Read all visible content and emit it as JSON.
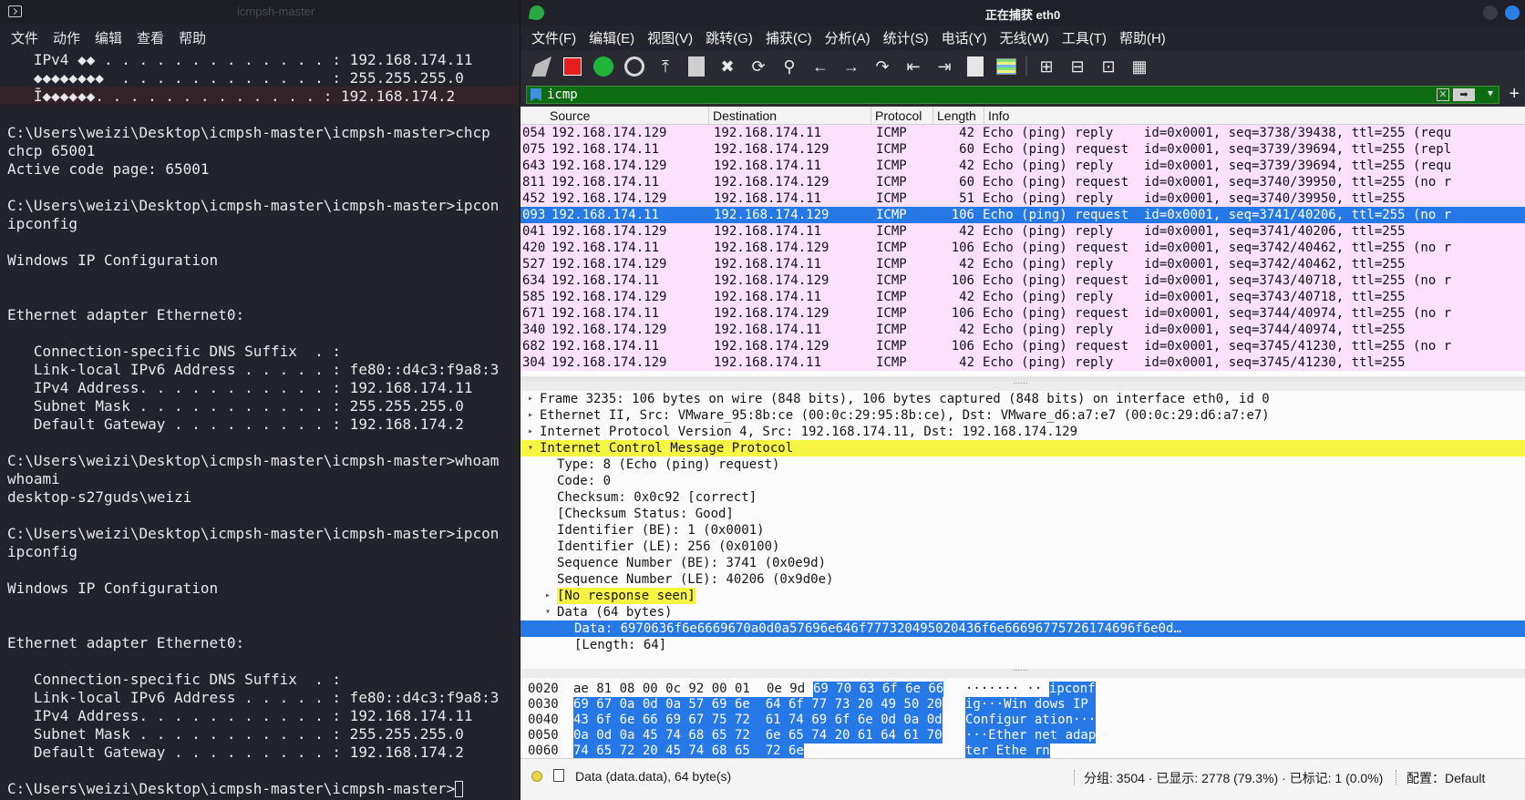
{
  "terminal": {
    "title": "icmpsh-master",
    "menu": [
      "文件",
      "动作",
      "编辑",
      "查看",
      "帮助"
    ],
    "lines": [
      "   IPv4 ◆◆ . . . . . . . . . . . . . : 192.168.174.11",
      "   ◆◆◆◆◆◆◆◆  . . . . . . . . . . . . : 255.255.255.0",
      "   Ī◆◆◆◆◆◆. . . . . . . . . . . . . : 192.168.174.2",
      "",
      "C:\\Users\\weizi\\Desktop\\icmpsh-master\\icmpsh-master>chcp",
      "chcp 65001",
      "Active code page: 65001",
      "",
      "C:\\Users\\weizi\\Desktop\\icmpsh-master\\icmpsh-master>ipcon",
      "ipconfig",
      "",
      "Windows IP Configuration",
      "",
      "",
      "Ethernet adapter Ethernet0:",
      "",
      "   Connection-specific DNS Suffix  . :",
      "   Link-local IPv6 Address . . . . . : fe80::d4c3:f9a8:3",
      "   IPv4 Address. . . . . . . . . . . : 192.168.174.11",
      "   Subnet Mask . . . . . . . . . . . : 255.255.255.0",
      "   Default Gateway . . . . . . . . . : 192.168.174.2",
      "",
      "C:\\Users\\weizi\\Desktop\\icmpsh-master\\icmpsh-master>whoam",
      "whoami",
      "desktop-s27guds\\weizi",
      "",
      "C:\\Users\\weizi\\Desktop\\icmpsh-master\\icmpsh-master>ipcon",
      "ipconfig",
      "",
      "Windows IP Configuration",
      "",
      "",
      "Ethernet adapter Ethernet0:",
      "",
      "   Connection-specific DNS Suffix  . :",
      "   Link-local IPv6 Address . . . . . : fe80::d4c3:f9a8:3",
      "   IPv4 Address. . . . . . . . . . . : 192.168.174.11",
      "   Subnet Mask . . . . . . . . . . . : 255.255.255.0",
      "   Default Gateway . . . . . . . . . : 192.168.174.2",
      ""
    ],
    "prompt": "C:\\Users\\weizi\\Desktop\\icmpsh-master\\icmpsh-master>"
  },
  "wireshark": {
    "title": "正在捕获 eth0",
    "menu": [
      "文件(F)",
      "编辑(E)",
      "视图(V)",
      "跳转(G)",
      "捕获(C)",
      "分析(A)",
      "统计(S)",
      "电话(Y)",
      "无线(W)",
      "工具(T)",
      "帮助(H)"
    ],
    "filter": "icmp",
    "columns": {
      "source": "Source",
      "destination": "Destination",
      "protocol": "Protocol",
      "length": "Length",
      "info": "Info"
    },
    "packets": [
      {
        "time": "054",
        "src": "192.168.174.129",
        "dst": "192.168.174.11",
        "proto": "ICMP",
        "len": "42",
        "info": "Echo (ping) reply    id=0x0001, seq=3738/39438, ttl=255 (requ"
      },
      {
        "time": "075",
        "src": "192.168.174.11",
        "dst": "192.168.174.129",
        "proto": "ICMP",
        "len": "60",
        "info": "Echo (ping) request  id=0x0001, seq=3739/39694, ttl=255 (repl"
      },
      {
        "time": "643",
        "src": "192.168.174.129",
        "dst": "192.168.174.11",
        "proto": "ICMP",
        "len": "42",
        "info": "Echo (ping) reply    id=0x0001, seq=3739/39694, ttl=255 (requ"
      },
      {
        "time": "811",
        "src": "192.168.174.11",
        "dst": "192.168.174.129",
        "proto": "ICMP",
        "len": "60",
        "info": "Echo (ping) request  id=0x0001, seq=3740/39950, ttl=255 (no r"
      },
      {
        "time": "452",
        "src": "192.168.174.129",
        "dst": "192.168.174.11",
        "proto": "ICMP",
        "len": "51",
        "info": "Echo (ping) reply    id=0x0001, seq=3740/39950, ttl=255"
      },
      {
        "time": "093",
        "src": "192.168.174.11",
        "dst": "192.168.174.129",
        "proto": "ICMP",
        "len": "106",
        "info": "Echo (ping) request  id=0x0001, seq=3741/40206, ttl=255 (no r",
        "selected": true
      },
      {
        "time": "041",
        "src": "192.168.174.129",
        "dst": "192.168.174.11",
        "proto": "ICMP",
        "len": "42",
        "info": "Echo (ping) reply    id=0x0001, seq=3741/40206, ttl=255"
      },
      {
        "time": "420",
        "src": "192.168.174.11",
        "dst": "192.168.174.129",
        "proto": "ICMP",
        "len": "106",
        "info": "Echo (ping) request  id=0x0001, seq=3742/40462, ttl=255 (no r"
      },
      {
        "time": "527",
        "src": "192.168.174.129",
        "dst": "192.168.174.11",
        "proto": "ICMP",
        "len": "42",
        "info": "Echo (ping) reply    id=0x0001, seq=3742/40462, ttl=255"
      },
      {
        "time": "634",
        "src": "192.168.174.11",
        "dst": "192.168.174.129",
        "proto": "ICMP",
        "len": "106",
        "info": "Echo (ping) request  id=0x0001, seq=3743/40718, ttl=255 (no r"
      },
      {
        "time": "585",
        "src": "192.168.174.129",
        "dst": "192.168.174.11",
        "proto": "ICMP",
        "len": "42",
        "info": "Echo (ping) reply    id=0x0001, seq=3743/40718, ttl=255"
      },
      {
        "time": "671",
        "src": "192.168.174.11",
        "dst": "192.168.174.129",
        "proto": "ICMP",
        "len": "106",
        "info": "Echo (ping) request  id=0x0001, seq=3744/40974, ttl=255 (no r"
      },
      {
        "time": "340",
        "src": "192.168.174.129",
        "dst": "192.168.174.11",
        "proto": "ICMP",
        "len": "42",
        "info": "Echo (ping) reply    id=0x0001, seq=3744/40974, ttl=255"
      },
      {
        "time": "682",
        "src": "192.168.174.11",
        "dst": "192.168.174.129",
        "proto": "ICMP",
        "len": "106",
        "info": "Echo (ping) request  id=0x0001, seq=3745/41230, ttl=255 (no r"
      },
      {
        "time": "304",
        "src": "192.168.174.129",
        "dst": "192.168.174.11",
        "proto": "ICMP",
        "len": "42",
        "info": "Echo (ping) reply    id=0x0001, seq=3745/41230, ttl=255"
      }
    ],
    "details": [
      {
        "text": "Frame 3235: 106 bytes on wire (848 bits), 106 bytes captured (848 bits) on interface eth0, id 0",
        "arrow": "▸",
        "indent": 0
      },
      {
        "text": "Ethernet II, Src: VMware_95:8b:ce (00:0c:29:95:8b:ce), Dst: VMware_d6:a7:e7 (00:0c:29:d6:a7:e7)",
        "arrow": "▸",
        "indent": 0
      },
      {
        "text": "Internet Protocol Version 4, Src: 192.168.174.11, Dst: 192.168.174.129",
        "arrow": "▸",
        "indent": 0
      },
      {
        "text": "Internet Control Message Protocol",
        "arrow": "▾",
        "indent": 0,
        "style": "hlfull"
      },
      {
        "text": "Type: 8 (Echo (ping) request)",
        "arrow": "",
        "indent": 1
      },
      {
        "text": "Code: 0",
        "arrow": "",
        "indent": 1
      },
      {
        "text": "Checksum: 0x0c92 [correct]",
        "arrow": "",
        "indent": 1
      },
      {
        "text": "[Checksum Status: Good]",
        "arrow": "",
        "indent": 1
      },
      {
        "text": "Identifier (BE): 1 (0x0001)",
        "arrow": "",
        "indent": 1
      },
      {
        "text": "Identifier (LE): 256 (0x0100)",
        "arrow": "",
        "indent": 1
      },
      {
        "text": "Sequence Number (BE): 3741 (0x0e9d)",
        "arrow": "",
        "indent": 1
      },
      {
        "text": "Sequence Number (LE): 40206 (0x9d0e)",
        "arrow": "",
        "indent": 1
      },
      {
        "text": "[No response seen]",
        "arrow": "▸",
        "indent": 1,
        "style": "hl"
      },
      {
        "text": "Data (64 bytes)",
        "arrow": "▾",
        "indent": 1
      },
      {
        "text": "Data: 6970636f6e6669670a0d0a57696e646f777320495020436f6e66696775726174696f6e0d…",
        "arrow": "",
        "indent": 2,
        "style": "sel"
      },
      {
        "text": "[Length: 64]",
        "arrow": "",
        "indent": 2
      }
    ],
    "bytes": [
      {
        "offset": "0020",
        "hexA": "ae 81 08 00 0c 92 00 01",
        "hexB": "0e 9d",
        "hexSel": "69 70 63 6f 6e 66",
        "asciiA": "······· ··",
        "asciiSel": "ipconf"
      },
      {
        "offset": "0030",
        "hexA": "",
        "hexB": "",
        "hexSel": "69 67 0a 0d 0a 57 69 6e  64 6f 77 73 20 49 50 20",
        "asciiA": "",
        "asciiSel": "ig···Win dows IP "
      },
      {
        "offset": "0040",
        "hexA": "",
        "hexB": "",
        "hexSel": "43 6f 6e 66 69 67 75 72  61 74 69 6f 6e 0d 0a 0d",
        "asciiA": "",
        "asciiSel": "Configur ation···"
      },
      {
        "offset": "0050",
        "hexA": "",
        "hexB": "",
        "hexSel": "0a 0d 0a 45 74 68 65 72  6e 65 74 20 61 64 61 70",
        "asciiA": "",
        "asciiSel": "···Ether net adap"
      },
      {
        "offset": "0060",
        "hexA": "",
        "hexB": "",
        "hexSel": "74 65 72 20 45 74 68 65  72 6e",
        "asciiA": "",
        "asciiSel": "ter Ethe rn"
      }
    ],
    "status": {
      "field": "Data (data.data), 64 byte(s)",
      "stats": "分组: 3504 · 已显示: 2778 (79.3%) · 已标记: 1 (0.0%)",
      "profile": "配置：Default"
    }
  }
}
